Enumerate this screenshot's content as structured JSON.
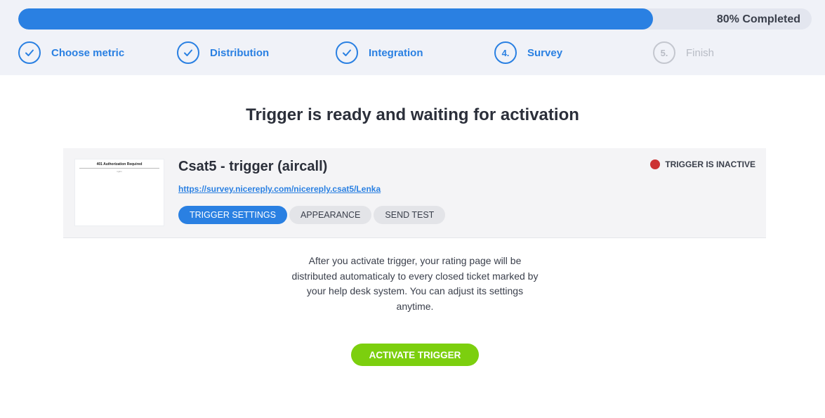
{
  "progress": {
    "value": 0.8,
    "label": "80% Completed"
  },
  "steps": [
    {
      "label": "Choose metric",
      "state": "done",
      "icon": "check-icon"
    },
    {
      "label": "Distribution",
      "state": "done",
      "icon": "check-icon"
    },
    {
      "label": "Integration",
      "state": "done",
      "icon": "check-icon"
    },
    {
      "number": "4.",
      "label": "Survey",
      "state": "current"
    },
    {
      "number": "5.",
      "label": "Finish",
      "state": "upcoming"
    }
  ],
  "heading": "Trigger is ready and waiting for activation",
  "card": {
    "thumbnail": {
      "title": "401 Authorization Required",
      "subtitle": "nginx"
    },
    "title": "Csat5 - trigger (aircall)",
    "link": "https://survey.nicereply.com/nicereply.csat5/Lenka",
    "tabs": [
      "TRIGGER SETTINGS",
      "APPEARANCE",
      "SEND TEST"
    ],
    "status": {
      "text": "TRIGGER IS INACTIVE",
      "color": "#cc3333"
    }
  },
  "description": "After you activate trigger, your rating page will be distributed automaticaly to every closed ticket marked by your help desk system. You can adjust its settings anytime.",
  "activate_button": "ACTIVATE TRIGGER",
  "colors": {
    "accent": "#2a80e2",
    "success": "#7ccf0e",
    "inactive": "#b8bcc5"
  }
}
